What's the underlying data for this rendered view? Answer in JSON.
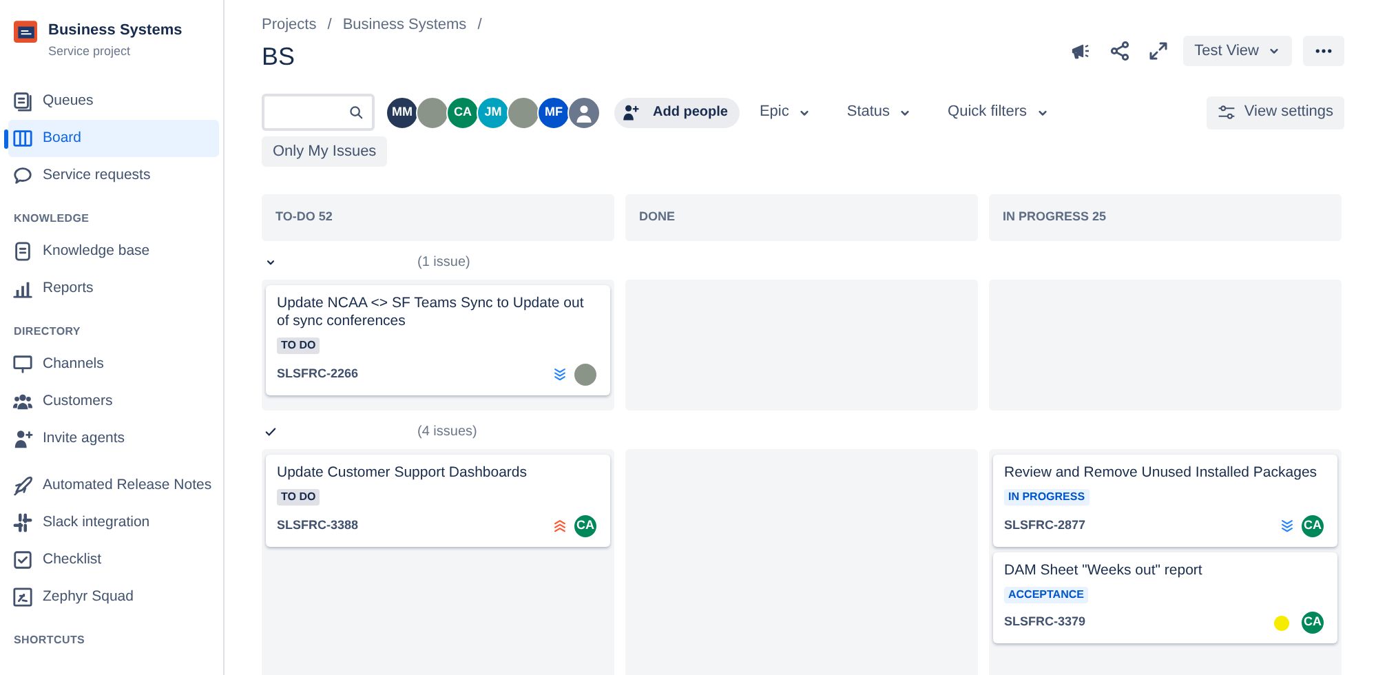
{
  "sidebar": {
    "project": {
      "name": "Business Systems",
      "type": "Service project"
    },
    "sections": [
      {
        "items": [
          {
            "label": "Queues",
            "selected": false
          },
          {
            "label": "Board",
            "selected": true
          },
          {
            "label": "Service requests",
            "selected": false
          }
        ]
      },
      {
        "heading": "KNOWLEDGE",
        "items": [
          {
            "label": "Knowledge base",
            "selected": false
          },
          {
            "label": "Reports",
            "selected": false
          }
        ]
      },
      {
        "heading": "DIRECTORY",
        "items": [
          {
            "label": "Channels",
            "selected": false
          },
          {
            "label": "Customers",
            "selected": false
          },
          {
            "label": "Invite agents",
            "selected": false
          }
        ]
      },
      {
        "items": [
          {
            "label": "Automated Release Notes",
            "selected": false
          },
          {
            "label": "Slack integration",
            "selected": false
          },
          {
            "label": "Checklist",
            "selected": false
          },
          {
            "label": "Zephyr Squad",
            "selected": false
          }
        ]
      },
      {
        "heading": "SHORTCUTS"
      }
    ]
  },
  "breadcrumbs": {
    "items": [
      "Projects",
      "Business Systems"
    ],
    "separator": "/"
  },
  "title": "BS",
  "view_select": {
    "label": "Test View"
  },
  "toolbar": {
    "avatars": [
      {
        "kind": "initials",
        "initials": "MM",
        "color": "#253858"
      },
      {
        "kind": "photo"
      },
      {
        "kind": "initials",
        "initials": "CA",
        "color": "#00875a"
      },
      {
        "kind": "initials",
        "initials": "JM",
        "color": "#00a3bf"
      },
      {
        "kind": "photo"
      },
      {
        "kind": "initials",
        "initials": "MF",
        "color": "#0052cc"
      },
      {
        "kind": "placeholder"
      }
    ],
    "add_people": "Add people",
    "filters": [
      "Epic",
      "Status",
      "Quick filters"
    ],
    "view_settings": "View settings",
    "quick_filter": {
      "label": "Only My Issues",
      "selected": false
    }
  },
  "columns": [
    {
      "title": "TO-DO 52"
    },
    {
      "title": "DONE"
    },
    {
      "title": "IN PROGRESS 25"
    }
  ],
  "swimlanes": [
    {
      "toggle": {
        "kind": "chevron"
      },
      "count": "(1 issue)",
      "cells": [
        [
          {
            "title": "Update NCAA <> SF Teams Sync to Update out of sync conferences",
            "status": {
              "text": "TO DO",
              "color": "#dfe1e6"
            },
            "key": "SLSFRC-2266",
            "priority": {
              "kind": "lowest"
            },
            "assignee": {
              "kind": "photo"
            }
          }
        ],
        [],
        []
      ]
    },
    {
      "toggle": {
        "kind": "check"
      },
      "count": "(4 issues)",
      "cells": [
        [
          {
            "title": "Update Customer Support Dashboards",
            "status": {
              "text": "TO DO",
              "color": "#dfe1e6"
            },
            "key": "SLSFRC-3388",
            "priority": {
              "kind": "highest"
            },
            "assignee": {
              "kind": "initials",
              "initials": "CA",
              "color": "#00875a"
            }
          }
        ],
        [],
        [
          {
            "title": "Review and Remove Unused Installed Packages",
            "status": {
              "text": "IN PROGRESS",
              "color": "#e9f2ff"
            },
            "key": "SLSFRC-2877",
            "priority": {
              "kind": "lowest"
            },
            "assignee": {
              "kind": "initials",
              "initials": "CA",
              "color": "#00875a"
            }
          },
          {
            "title": "DAM Sheet \"Weeks out\" report",
            "status": {
              "text": "ACCEPTANCE",
              "color": "#e9f2ff"
            },
            "key": "SLSFRC-3379",
            "color": "#f5ec00",
            "assignee": {
              "kind": "initials",
              "initials": "CA",
              "color": "#00875a"
            }
          }
        ]
      ]
    }
  ]
}
